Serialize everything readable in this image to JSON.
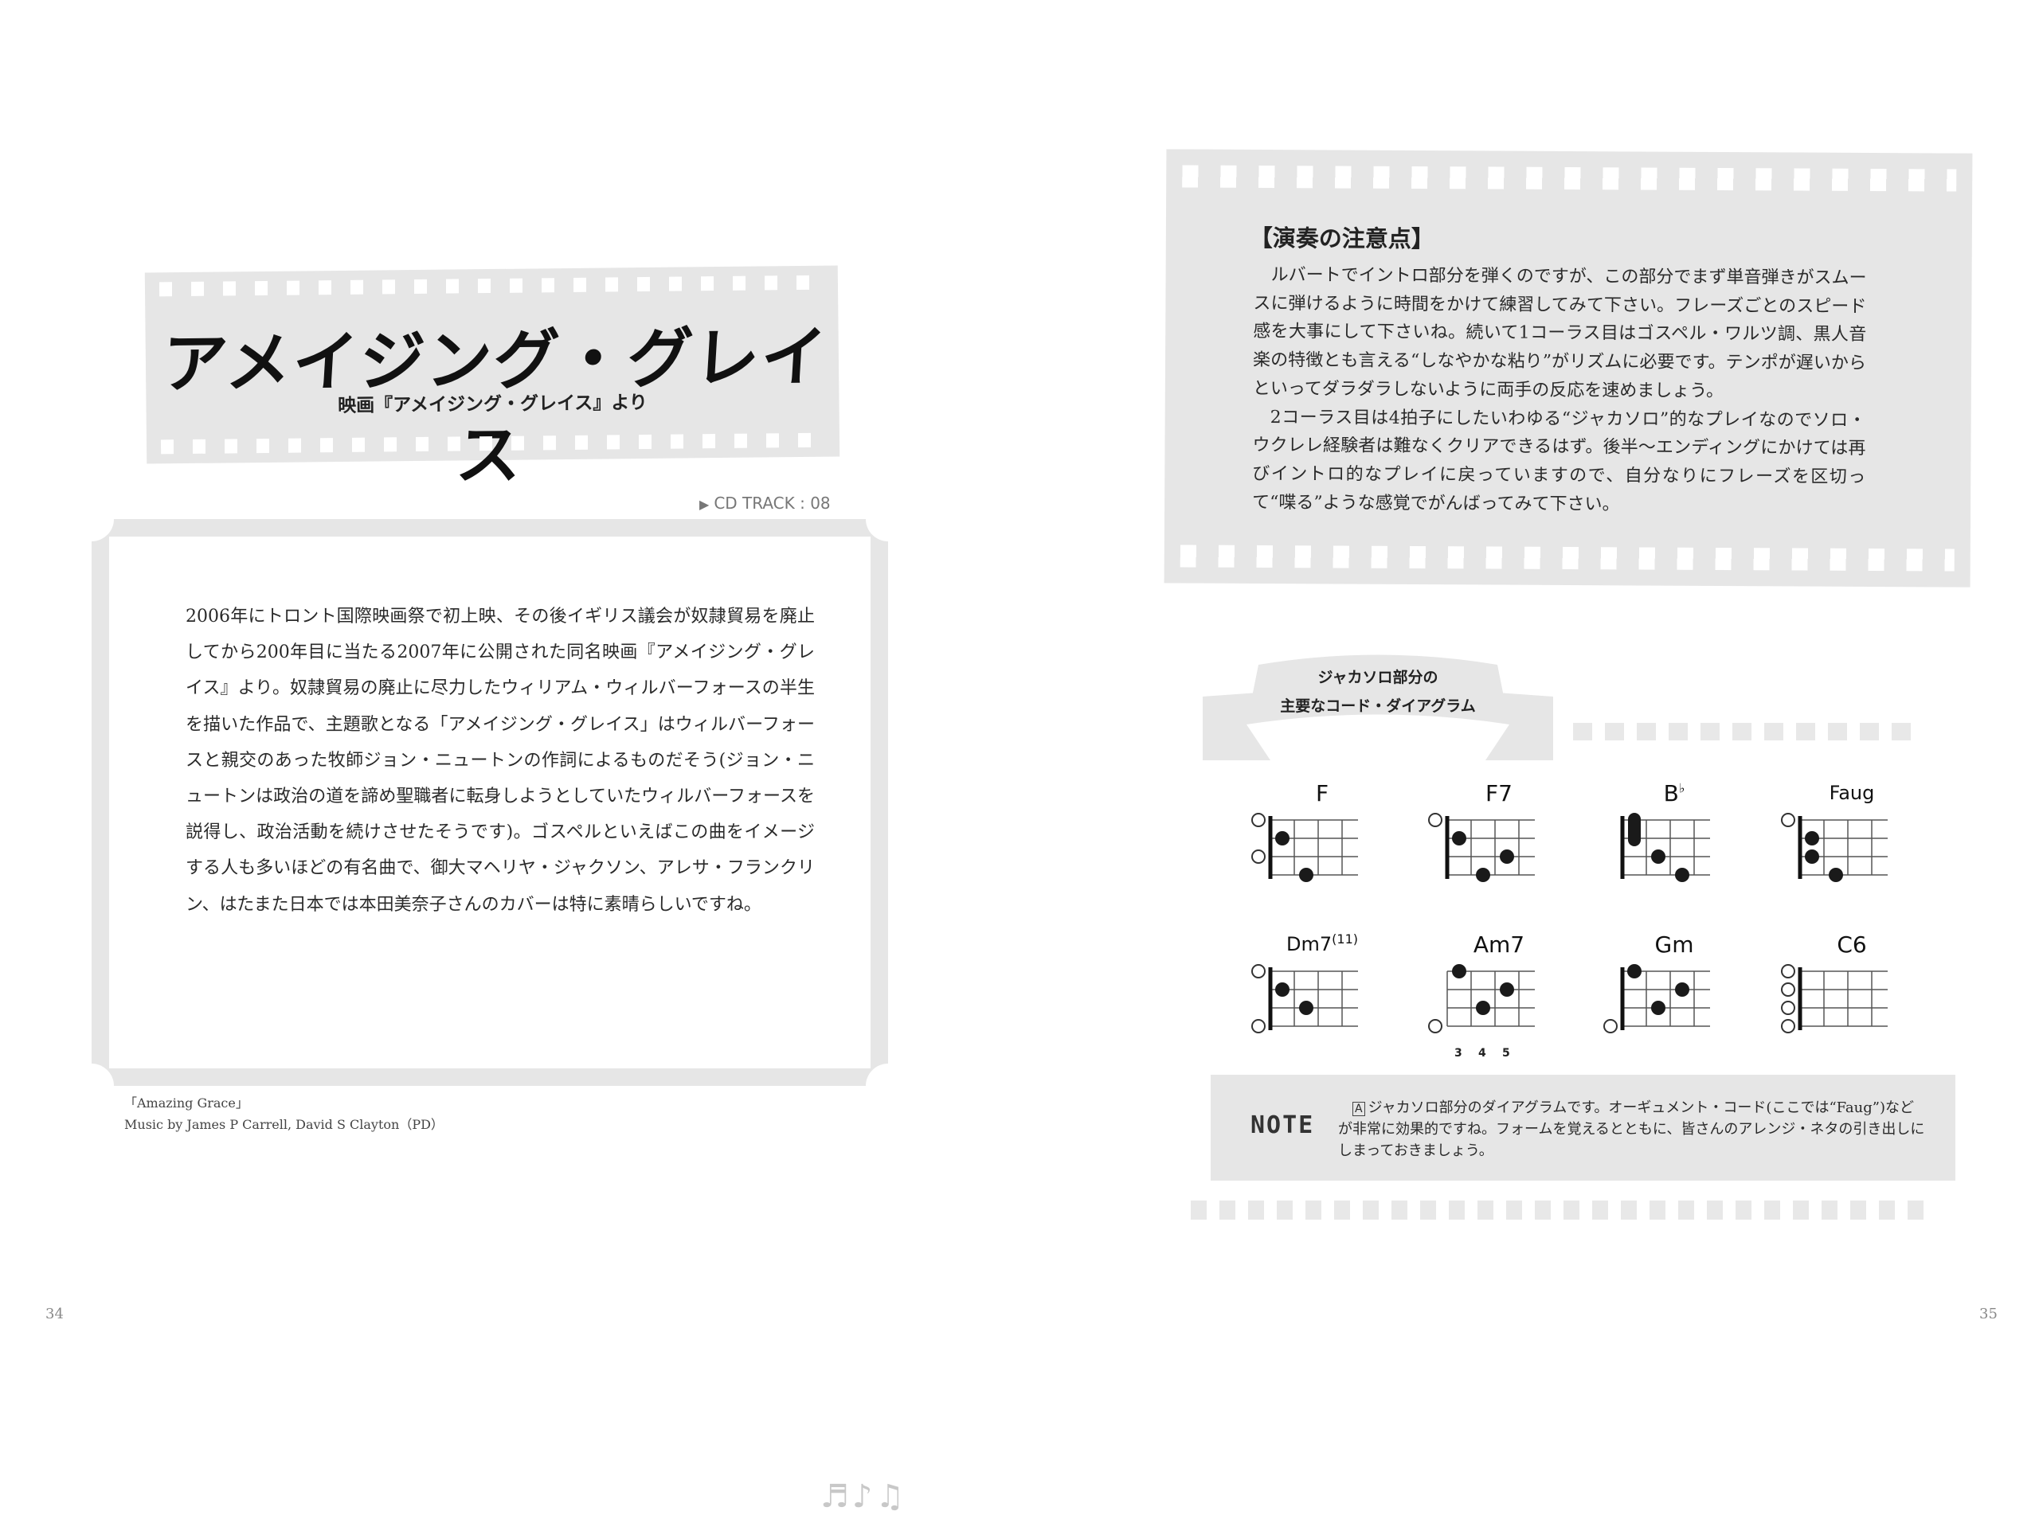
{
  "left_page": {
    "title": "アメイジング・グレイス",
    "subtitle": "映画『アメイジング・グレイス』より",
    "cd_track": "CD TRACK : 08",
    "description": "2006年にトロント国際映画祭で初上映、その後イギリス議会が奴隷貿易を廃止してから200年目に当たる2007年に公開された同名映画『アメイジング・グレイス』より。奴隷貿易の廃止に尽力したウィリアム・ウィルバーフォースの半生を描いた作品で、主題歌となる「アメイジング・グレイス」はウィルバーフォースと親交のあった牧師ジョン・ニュートンの作詞によるものだそう(ジョン・ニュートンは政治の道を諦め聖職者に転身しようとしていたウィルバーフォースを説得し、政治活動を続けさせたそうです)。ゴスペルといえばこの曲をイメージする人も多いほどの有名曲で、御大マヘリヤ・ジャクソン、アレサ・フランクリン、はたまた日本では本田美奈子さんのカバーは特に素晴らしいですね。",
    "credit_line1": "「Amazing Grace」",
    "credit_line2": "Music by James P Carrell, David S Clayton（PD）",
    "page_number": "34"
  },
  "right_page": {
    "tips_heading": "【演奏の注意点】",
    "tips_paragraph1": "ルバートでイントロ部分を弾くのですが、この部分でまず単音弾きがスムースに弾けるように時間をかけて練習してみて下さい。フレーズごとのスピード感を大事にして下さいね。続いて1コーラス目はゴスペル・ワルツ調、黒人音楽の特徴とも言える“しなやかな粘り”がリズムに必要です。テンポが遅いからといってダラダラしないように両手の反応を速めましょう。",
    "tips_paragraph2": "2コーラス目は4拍子にしたいわゆる“ジャカソロ”的なプレイなのでソロ・ウクレレ経験者は難なくクリアできるはず。後半〜エンディングにかけては再びイントロ的なプレイに戻っていますので、自分なりにフレーズを区切って“喋る”ような感覚でがんばってみて下さい。",
    "ribbon_line1": "ジャカソロ部分の",
    "ribbon_line2": "主要なコード・ダイアグラム",
    "chords": [
      {
        "name": "F",
        "sup": ""
      },
      {
        "name": "F7",
        "sup": ""
      },
      {
        "name": "B",
        "sup": "♭"
      },
      {
        "name": "Faug",
        "sup": ""
      },
      {
        "name": "Dm7",
        "sup": "(11)"
      },
      {
        "name": "Am7",
        "sup": ""
      },
      {
        "name": "Gm",
        "sup": ""
      },
      {
        "name": "C6",
        "sup": ""
      }
    ],
    "fret_numbers": [
      "3",
      "4",
      "5"
    ],
    "note_label": "NOTE",
    "note_marker": "A",
    "note_text": "ジャカソロ部分のダイアグラムです。オーギュメント・コード(ここでは“Faug”)などが非常に効果的ですね。フォームを覚えるとともに、皆さんのアレンジ・ネタの引き出しにしまっておきましょう。",
    "page_number": "35"
  }
}
